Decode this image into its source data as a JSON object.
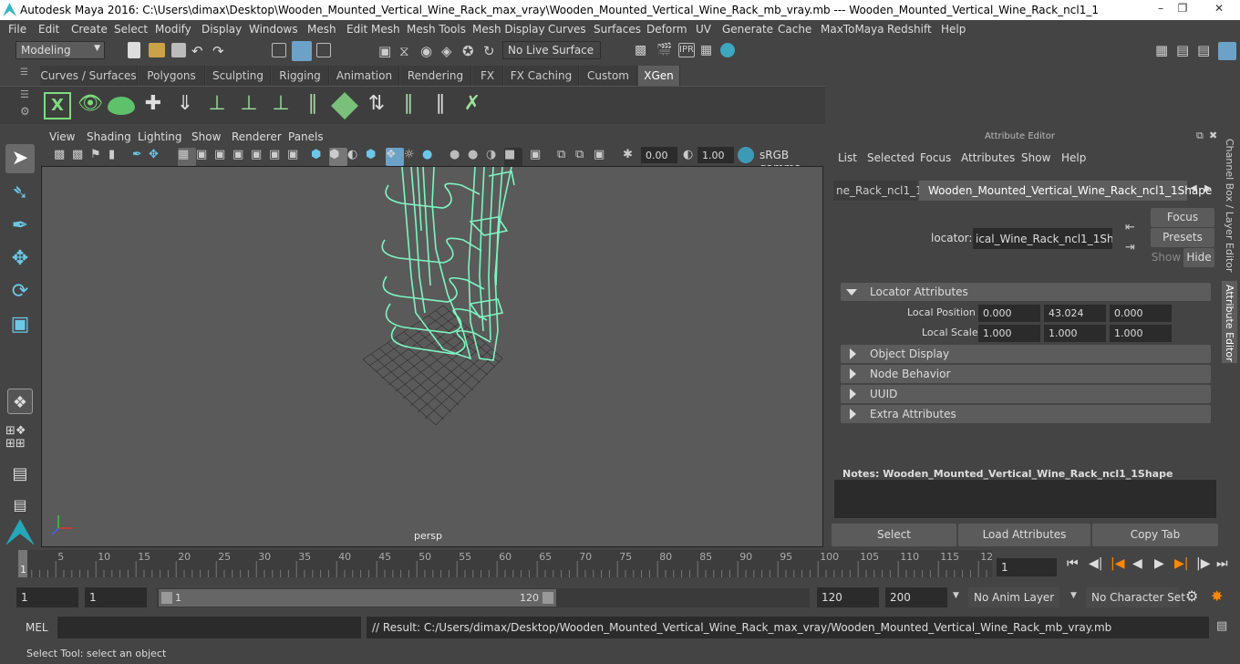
{
  "titlebar": {
    "title": "Autodesk Maya 2016: C:\\Users\\dimax\\Desktop\\Wooden_Mounted_Vertical_Wine_Rack_max_vray\\Wooden_Mounted_Vertical_Wine_Rack_mb_vray.mb  ---  Wooden_Mounted_Vertical_Wine_Rack_ncl1_1"
  },
  "menubar": [
    "File",
    "Edit",
    "Create",
    "Select",
    "Modify",
    "Display",
    "Windows",
    "Mesh",
    "Edit Mesh",
    "Mesh Tools",
    "Mesh Display",
    "Curves",
    "Surfaces",
    "Deform",
    "UV",
    "Generate",
    "Cache",
    "MaxToMaya",
    "Redshift",
    "Help"
  ],
  "statusline": {
    "mode": "Modeling",
    "live_surface": "No Live Surface"
  },
  "shelf_tabs": [
    "Curves / Surfaces",
    "Polygons",
    "Sculpting",
    "Rigging",
    "Animation",
    "Rendering",
    "FX",
    "FX Caching",
    "Custom",
    "XGen"
  ],
  "viewport": {
    "menus": [
      "View",
      "Shading",
      "Lighting",
      "Show",
      "Renderer",
      "Panels"
    ],
    "field_a": "0.00",
    "field_b": "1.00",
    "color_space": "sRGB gamma",
    "camera_label": "persp"
  },
  "attribute_editor": {
    "header": "Attribute Editor",
    "menus": [
      "List",
      "Selected",
      "Focus",
      "Attributes",
      "Show",
      "Help"
    ],
    "tab_left": "ne_Rack_ncl1_1",
    "tab_active": "Wooden_Mounted_Vertical_Wine_Rack_ncl1_1Shape",
    "locator_label": "locator:",
    "locator_value": "ical_Wine_Rack_ncl1_1Shape",
    "focus_btn": "Focus",
    "presets_btn": "Presets",
    "show_btn": "Show",
    "hide_btn": "Hide",
    "sections": {
      "locator": "Locator Attributes",
      "object_display": "Object Display",
      "node_behavior": "Node Behavior",
      "uuid": "UUID",
      "extra": "Extra Attributes"
    },
    "local_position": {
      "label": "Local Position",
      "x": "0.000",
      "y": "43.024",
      "z": "0.000"
    },
    "local_scale": {
      "label": "Local Scale",
      "x": "1.000",
      "y": "1.000",
      "z": "1.000"
    },
    "notes_label": "Notes:  Wooden_Mounted_Vertical_Wine_Rack_ncl1_1Shape",
    "select_btn": "Select",
    "load_btn": "Load Attributes",
    "copy_btn": "Copy Tab"
  },
  "side_tabs": {
    "channel": "Channel Box / Layer Editor",
    "attr": "Attribute Editor"
  },
  "timeline": {
    "ticks": [
      "1",
      "5",
      "10",
      "15",
      "20",
      "25",
      "30",
      "35",
      "40",
      "45",
      "50",
      "55",
      "60",
      "65",
      "70",
      "75",
      "80",
      "85",
      "90",
      "95",
      "100",
      "105",
      "110",
      "115",
      "12"
    ],
    "current_frame": "1"
  },
  "range": {
    "start": "1",
    "start2": "1",
    "slider_start": "1",
    "slider_end": "120",
    "end": "120",
    "end2": "200",
    "anim_layer": "No Anim Layer",
    "char_set": "No Character Set"
  },
  "command": {
    "label": "MEL",
    "result": "// Result: C:/Users/dimax/Desktop/Wooden_Mounted_Vertical_Wine_Rack_max_vray/Wooden_Mounted_Vertical_Wine_Rack_mb_vray.mb"
  },
  "help_line": "Select Tool: select an object"
}
